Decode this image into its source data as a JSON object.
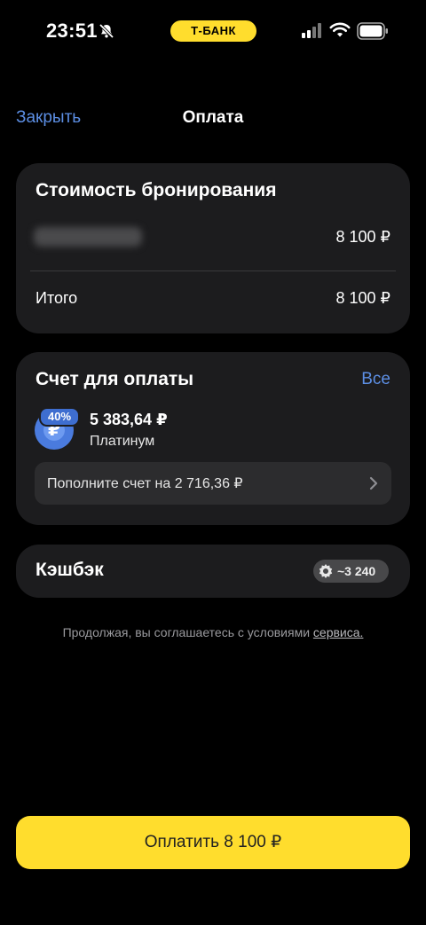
{
  "status_bar": {
    "time": "23:51",
    "bank_label": "Т-БАНК",
    "icons": [
      "bell-slash-icon",
      "signal-icon",
      "wifi-icon",
      "battery-icon"
    ]
  },
  "nav": {
    "close_label": "Закрыть",
    "title": "Оплата"
  },
  "booking": {
    "title": "Стоимость бронирования",
    "item_amount": "8 100 ₽",
    "total_label": "Итого",
    "total_amount": "8 100 ₽"
  },
  "account": {
    "title": "Счет для оплаты",
    "all_label": "Все",
    "cashback_badge": "40%",
    "currency_symbol": "₽",
    "balance": "5 383,64 ₽",
    "name": "Платинум",
    "topup_text": "Пополните счет на 2 716,36 ₽"
  },
  "cashback": {
    "label": "Кэшбэк",
    "value": "~3 240"
  },
  "terms": {
    "text": "Продолжая, вы соглашаетесь с условиями ",
    "link": "сервиса."
  },
  "pay_button": {
    "label": "Оплатить 8 100 ₽"
  },
  "colors": {
    "accent_yellow": "#ffdd2d",
    "link_blue": "#5c8ee3",
    "card_bg": "#1c1c1e"
  }
}
